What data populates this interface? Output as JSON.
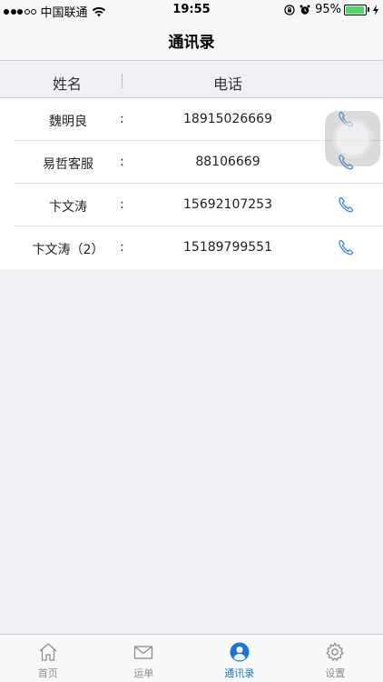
{
  "status_bar": {
    "carrier": "中国联通",
    "time": "19:55",
    "battery": "95%",
    "battery_level": 0.95,
    "signal_bars": 3,
    "icons": [
      "wifi-icon",
      "rotation-lock-icon",
      "alarm-icon",
      "charging-bolt-icon"
    ]
  },
  "nav": {
    "title": "通讯录"
  },
  "columns": {
    "name": "姓名",
    "phone": "电话"
  },
  "separator": ":",
  "contacts": [
    {
      "name": "魏明良",
      "phone": "18915026669"
    },
    {
      "name": "易哲客服",
      "phone": "88106669"
    },
    {
      "name": "卞文涛",
      "phone": "15692107253"
    },
    {
      "name": "卞文涛（2）",
      "phone": "15189799551"
    }
  ],
  "tabs": [
    {
      "label": "首页",
      "icon": "home-icon"
    },
    {
      "label": "运单",
      "icon": "mail-icon"
    },
    {
      "label": "通讯录",
      "icon": "contacts-icon",
      "active": true
    },
    {
      "label": "设置",
      "icon": "gear-icon"
    }
  ],
  "colors": {
    "accent": "#1a73d9",
    "call_icon": "#3a86d6",
    "battery": "#4cd964",
    "background": "#efeff4"
  }
}
